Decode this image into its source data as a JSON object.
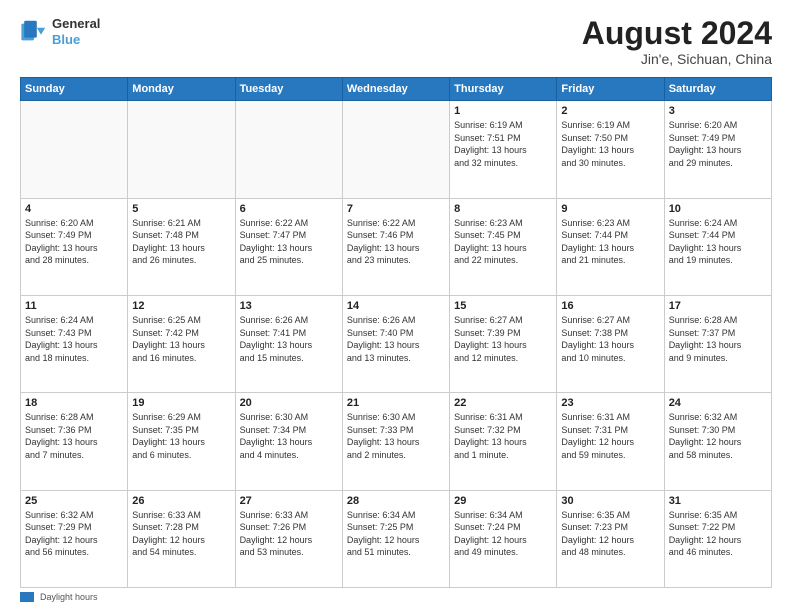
{
  "header": {
    "logo_line1": "General",
    "logo_line2": "Blue",
    "month_year": "August 2024",
    "location": "Jin'e, Sichuan, China"
  },
  "days_of_week": [
    "Sunday",
    "Monday",
    "Tuesday",
    "Wednesday",
    "Thursday",
    "Friday",
    "Saturday"
  ],
  "footer": {
    "daylight_label": "Daylight hours"
  },
  "weeks": [
    [
      {
        "num": "",
        "info": "",
        "empty": true
      },
      {
        "num": "",
        "info": "",
        "empty": true
      },
      {
        "num": "",
        "info": "",
        "empty": true
      },
      {
        "num": "",
        "info": "",
        "empty": true
      },
      {
        "num": "1",
        "info": "Sunrise: 6:19 AM\nSunset: 7:51 PM\nDaylight: 13 hours\nand 32 minutes."
      },
      {
        "num": "2",
        "info": "Sunrise: 6:19 AM\nSunset: 7:50 PM\nDaylight: 13 hours\nand 30 minutes."
      },
      {
        "num": "3",
        "info": "Sunrise: 6:20 AM\nSunset: 7:49 PM\nDaylight: 13 hours\nand 29 minutes."
      }
    ],
    [
      {
        "num": "4",
        "info": "Sunrise: 6:20 AM\nSunset: 7:49 PM\nDaylight: 13 hours\nand 28 minutes."
      },
      {
        "num": "5",
        "info": "Sunrise: 6:21 AM\nSunset: 7:48 PM\nDaylight: 13 hours\nand 26 minutes."
      },
      {
        "num": "6",
        "info": "Sunrise: 6:22 AM\nSunset: 7:47 PM\nDaylight: 13 hours\nand 25 minutes."
      },
      {
        "num": "7",
        "info": "Sunrise: 6:22 AM\nSunset: 7:46 PM\nDaylight: 13 hours\nand 23 minutes."
      },
      {
        "num": "8",
        "info": "Sunrise: 6:23 AM\nSunset: 7:45 PM\nDaylight: 13 hours\nand 22 minutes."
      },
      {
        "num": "9",
        "info": "Sunrise: 6:23 AM\nSunset: 7:44 PM\nDaylight: 13 hours\nand 21 minutes."
      },
      {
        "num": "10",
        "info": "Sunrise: 6:24 AM\nSunset: 7:44 PM\nDaylight: 13 hours\nand 19 minutes."
      }
    ],
    [
      {
        "num": "11",
        "info": "Sunrise: 6:24 AM\nSunset: 7:43 PM\nDaylight: 13 hours\nand 18 minutes."
      },
      {
        "num": "12",
        "info": "Sunrise: 6:25 AM\nSunset: 7:42 PM\nDaylight: 13 hours\nand 16 minutes."
      },
      {
        "num": "13",
        "info": "Sunrise: 6:26 AM\nSunset: 7:41 PM\nDaylight: 13 hours\nand 15 minutes."
      },
      {
        "num": "14",
        "info": "Sunrise: 6:26 AM\nSunset: 7:40 PM\nDaylight: 13 hours\nand 13 minutes."
      },
      {
        "num": "15",
        "info": "Sunrise: 6:27 AM\nSunset: 7:39 PM\nDaylight: 13 hours\nand 12 minutes."
      },
      {
        "num": "16",
        "info": "Sunrise: 6:27 AM\nSunset: 7:38 PM\nDaylight: 13 hours\nand 10 minutes."
      },
      {
        "num": "17",
        "info": "Sunrise: 6:28 AM\nSunset: 7:37 PM\nDaylight: 13 hours\nand 9 minutes."
      }
    ],
    [
      {
        "num": "18",
        "info": "Sunrise: 6:28 AM\nSunset: 7:36 PM\nDaylight: 13 hours\nand 7 minutes."
      },
      {
        "num": "19",
        "info": "Sunrise: 6:29 AM\nSunset: 7:35 PM\nDaylight: 13 hours\nand 6 minutes."
      },
      {
        "num": "20",
        "info": "Sunrise: 6:30 AM\nSunset: 7:34 PM\nDaylight: 13 hours\nand 4 minutes."
      },
      {
        "num": "21",
        "info": "Sunrise: 6:30 AM\nSunset: 7:33 PM\nDaylight: 13 hours\nand 2 minutes."
      },
      {
        "num": "22",
        "info": "Sunrise: 6:31 AM\nSunset: 7:32 PM\nDaylight: 13 hours\nand 1 minute."
      },
      {
        "num": "23",
        "info": "Sunrise: 6:31 AM\nSunset: 7:31 PM\nDaylight: 12 hours\nand 59 minutes."
      },
      {
        "num": "24",
        "info": "Sunrise: 6:32 AM\nSunset: 7:30 PM\nDaylight: 12 hours\nand 58 minutes."
      }
    ],
    [
      {
        "num": "25",
        "info": "Sunrise: 6:32 AM\nSunset: 7:29 PM\nDaylight: 12 hours\nand 56 minutes."
      },
      {
        "num": "26",
        "info": "Sunrise: 6:33 AM\nSunset: 7:28 PM\nDaylight: 12 hours\nand 54 minutes."
      },
      {
        "num": "27",
        "info": "Sunrise: 6:33 AM\nSunset: 7:26 PM\nDaylight: 12 hours\nand 53 minutes."
      },
      {
        "num": "28",
        "info": "Sunrise: 6:34 AM\nSunset: 7:25 PM\nDaylight: 12 hours\nand 51 minutes."
      },
      {
        "num": "29",
        "info": "Sunrise: 6:34 AM\nSunset: 7:24 PM\nDaylight: 12 hours\nand 49 minutes."
      },
      {
        "num": "30",
        "info": "Sunrise: 6:35 AM\nSunset: 7:23 PM\nDaylight: 12 hours\nand 48 minutes."
      },
      {
        "num": "31",
        "info": "Sunrise: 6:35 AM\nSunset: 7:22 PM\nDaylight: 12 hours\nand 46 minutes."
      }
    ]
  ]
}
